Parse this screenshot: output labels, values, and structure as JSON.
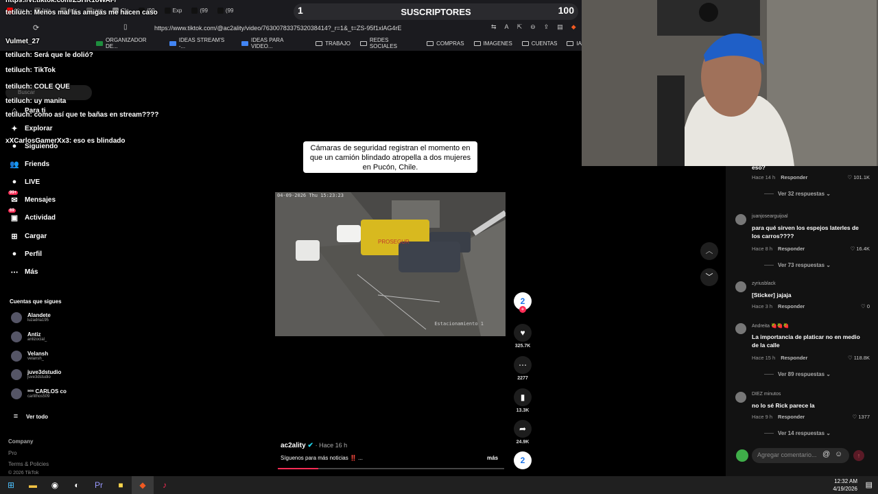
{
  "browser": {
    "tabs": [
      {
        "label": "You",
        "color": "#ff0000"
      },
      {
        "label": "Inic",
        "color": "#555555"
      },
      {
        "label": "Inic",
        "color": "#555555"
      },
      {
        "label": "are",
        "color": "#555555"
      },
      {
        "label": "Cla",
        "color": "#888888"
      },
      {
        "label": "(99",
        "color": "#111111"
      },
      {
        "label": "Exp",
        "color": "#111111"
      },
      {
        "label": "(99",
        "color": "#111111"
      },
      {
        "label": "(99",
        "color": "#111111"
      }
    ],
    "url": "https://www.tiktok.com/@ac2ality/video/7630078337532038414?_r=1&_t=ZS-95f1xlAG4rE",
    "bookmarks": [
      "ORGANIZADOR DE...",
      "IDEAS STREAM'S -...",
      "IDEAS PARA VIDEO...",
      "TRABAJO",
      "REDES SOCIALES",
      "COMPRAS",
      "IMAGENES",
      "CUENTAS",
      "IA"
    ]
  },
  "subscribers": {
    "label": "SUSCRIPTORES",
    "count": "100",
    "start": "1"
  },
  "chat": [
    {
      "user": "",
      "text": "https://vt.tiktok.com/ZSHK1oWAF/"
    },
    {
      "user": "tetiluch:",
      "text": "Menos mal las amigas me hacen caso"
    },
    {
      "user": "",
      "text": "Vulmet_27"
    },
    {
      "user": "tetiluch:",
      "text": "Será que le dolió?"
    },
    {
      "user": "tetiluch:",
      "text": "TikTok"
    },
    {
      "user": "tetiluch:",
      "text": "COLE QUE"
    },
    {
      "user": "tetiluch:",
      "text": "uy manita"
    },
    {
      "user": "tetiluch:",
      "text": "como así que te bañas en stream????"
    },
    {
      "user": "xXCarlosGamerXx3:",
      "text": "eso es blindado"
    }
  ],
  "sidebar": {
    "search_placeholder": "Buscar",
    "nav": [
      {
        "label": "Para ti",
        "icon": "home-icon"
      },
      {
        "label": "Explorar",
        "icon": "compass-icon"
      },
      {
        "label": "Siguiendo",
        "icon": "following-icon"
      },
      {
        "label": "Friends",
        "icon": "friends-icon"
      },
      {
        "label": "LIVE",
        "icon": "live-icon"
      },
      {
        "label": "Mensajes",
        "icon": "messages-icon",
        "badge": "99+"
      },
      {
        "label": "Actividad",
        "icon": "activity-icon",
        "badge": "69"
      },
      {
        "label": "Cargar",
        "icon": "upload-icon"
      },
      {
        "label": "Perfil",
        "icon": "profile-icon"
      },
      {
        "label": "Más",
        "icon": "more-icon"
      }
    ],
    "following_title": "Cuentas que sigues",
    "following": [
      {
        "name": "Alandete",
        "handle": "luzadria195"
      },
      {
        "name": "Antiz",
        "handle": "antizocial_"
      },
      {
        "name": "Velansh",
        "handle": "velansh_"
      },
      {
        "name": "juve3dstudio",
        "handle": "juve3dstudio"
      },
      {
        "name": "ˢᵒˢ CARLOS co",
        "handle": "carlithos509"
      }
    ],
    "see_all": "Ver todo",
    "footer": {
      "company": "Company",
      "program": "Pro",
      "terms": "Terms & Policies",
      "copyright": "© 2026 TikTok"
    }
  },
  "video": {
    "caption": "Cámaras de seguridad registran el momento en que un camión blindado atropella a dos mujeres en Pucón, Chile.",
    "timestamp": "04-09-2026 Thu 15:23:23",
    "cam_label": "Estacionamiento 1",
    "truck_text": "PROSEGUR",
    "author": "ac2ality",
    "posted": "· Hace 16 h",
    "description": "Síguenos para más noticias ‼️ ...",
    "more": "más",
    "progress": 0.18
  },
  "actions": {
    "likes": "325.7K",
    "comments": "2277",
    "saves": "13.3K",
    "shares": "24.9K"
  },
  "comments": {
    "items": [
      {
        "user": "",
        "text": "eso?",
        "time": "Hace 14 h",
        "reply": "Responder",
        "likes": "101.1K",
        "replies": "Ver 32 respuestas"
      },
      {
        "user": "juanjosearguijoal",
        "text": "para qué sirven los espejos laterles de los carros????",
        "time": "Hace 8 h",
        "reply": "Responder",
        "likes": "16.4K",
        "replies": "Ver 73 respuestas"
      },
      {
        "user": "zyriusblack",
        "text": "[Sticker] jajaja",
        "time": "Hace 3 h",
        "reply": "Responder",
        "likes": "0",
        "replies": ""
      },
      {
        "user": "Andreita 🍓🍓🍓",
        "text": "La importancia de platicar no en medio de la calle",
        "time": "Hace 15 h",
        "reply": "Responder",
        "likes": "118.8K",
        "replies": "Ver 89 respuestas"
      },
      {
        "user": "DIEZ minutos",
        "text": "no lo sé Rick parece la",
        "time": "Hace 9 h",
        "reply": "Responder",
        "likes": "1377",
        "replies": "Ver 14 respuestas"
      }
    ],
    "input_placeholder": "Agregar comentario..."
  },
  "taskbar": {
    "time": "12:32 AM",
    "date": "4/19/2026"
  }
}
